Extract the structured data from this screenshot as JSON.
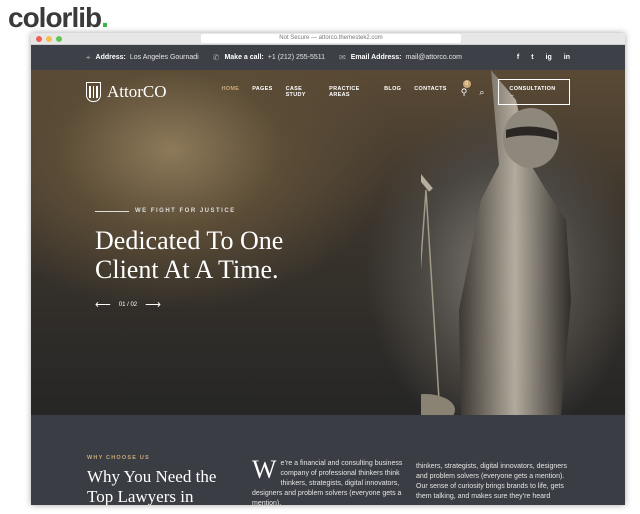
{
  "brand": {
    "watermark": "colorlib",
    "dot": "."
  },
  "browser": {
    "url": "Not Secure — attorco.themestek2.com"
  },
  "topbar": {
    "address_label": "Address:",
    "address": "Los Angeles Gournadi",
    "call_label": "Make a call:",
    "phone": "+1 (212) 255-5511",
    "email_label": "Email Address:",
    "email": "mail@attorco.com",
    "social": [
      "f",
      "t",
      "ig",
      "in"
    ]
  },
  "nav": {
    "logo": "AttorCO",
    "items": [
      "HOME",
      "PAGES",
      "CASE STUDY",
      "PRACTICE AREAS",
      "BLOG",
      "CONTACTS"
    ],
    "cart_count": "0",
    "consult": "CONSULTATION →"
  },
  "hero": {
    "kicker": "WE FIGHT FOR JUSTICE",
    "title": "Dedicated To One Client At A Time.",
    "slide": "01 / 02",
    "prev": "⟵",
    "next": "⟶"
  },
  "why": {
    "kicker": "WHY CHOOSE US",
    "title": "Why You Need the Top Lawyers in",
    "dropcap": "W",
    "para1": "e’re a financial and consulting business company of professional thinkers think thinkers, strategists, digital innovators, designers and problem solvers (everyone gets a mention).",
    "para2": "thinkers, strategists, digital innovators, designers and problem solvers (everyone gets a mention). Our sense of curiosity brings brands to life, gets them talking, and makes sure they’re heard"
  },
  "colors": {
    "accent": "#c9a978",
    "dark": "#3a3d43"
  }
}
